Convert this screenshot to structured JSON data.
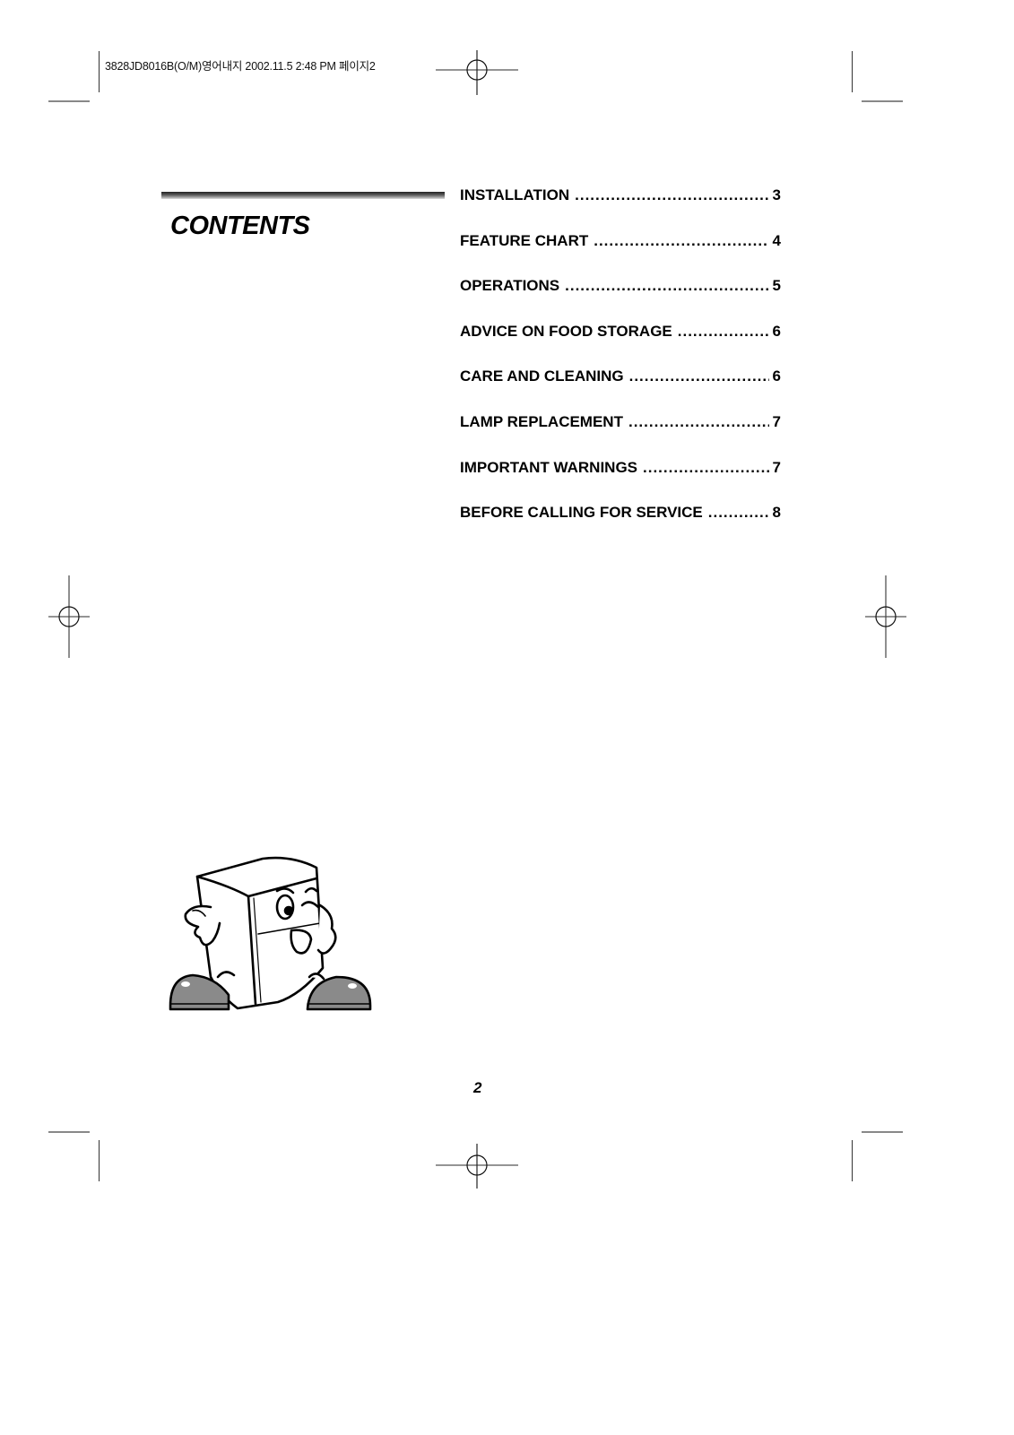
{
  "print_slug": "3828JD8016B(O/M)영어내지  2002.11.5 2:48 PM 페이지2",
  "heading": "CONTENTS",
  "toc": [
    {
      "label": "INSTALLATION",
      "page": "3"
    },
    {
      "label": "FEATURE CHART",
      "page": "4"
    },
    {
      "label": "OPERATIONS",
      "page": "5"
    },
    {
      "label": "ADVICE ON FOOD STORAGE",
      "page": "6"
    },
    {
      "label": "CARE AND CLEANING",
      "page": "6"
    },
    {
      "label": "LAMP REPLACEMENT",
      "page": "7"
    },
    {
      "label": "IMPORTANT WARNINGS",
      "page": "7"
    },
    {
      "label": "BEFORE CALLING FOR SERVICE",
      "page": "8"
    }
  ],
  "dot_leader": "........................................................................................",
  "page_number": "2",
  "illustration": "refrigerator-mascot-winking"
}
